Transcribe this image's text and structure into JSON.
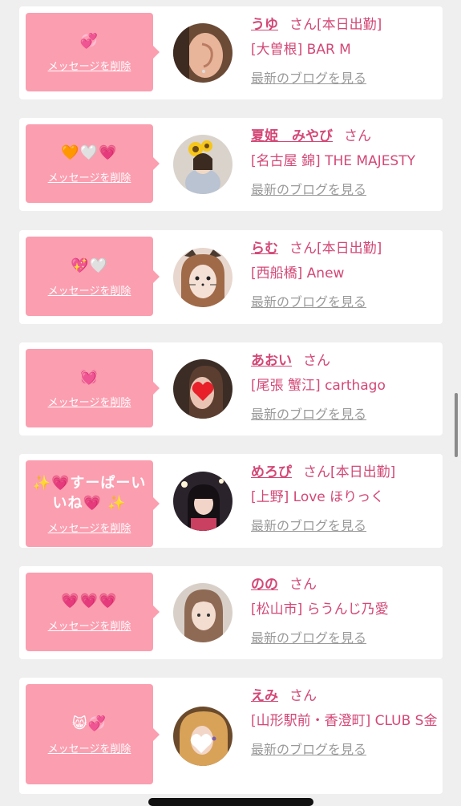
{
  "cards": [
    {
      "emoji": "💞",
      "name": "うゆ",
      "san": "さん",
      "status": "[本日出勤]",
      "shop": "[大曽根] BAR M",
      "delete": "メッセージを削除",
      "blog": "最新のブログを見る",
      "avatar": "ear"
    },
    {
      "emoji": "🧡🤍💗",
      "name": "夏姫　みやび",
      "san": "さん",
      "status": "",
      "shop": "[名古屋 錦] THE MAJESTY",
      "delete": "メッセージを削除",
      "blog": "最新のブログを見る",
      "avatar": "sunflower"
    },
    {
      "emoji": "💖🤍",
      "name": "らむ",
      "san": "さん",
      "status": "[本日出勤]",
      "shop": "[西船橋] Anew",
      "delete": "メッセージを削除",
      "blog": "最新のブログを見る",
      "avatar": "cat"
    },
    {
      "emoji": "💓",
      "name": "あおい",
      "san": "さん",
      "status": "",
      "shop": "[尾張 蟹江] carthago",
      "delete": "メッセージを削除",
      "blog": "最新のブログを見る",
      "avatar": "heart"
    },
    {
      "emoji": "✨💗すーぱーいいね💗 ✨",
      "name": "めろぴ",
      "san": "さん",
      "status": "[本日出勤]",
      "shop": "[上野] Love ほりっく",
      "delete": "メッセージを削除",
      "blog": "最新のブログを見る",
      "avatar": "dark"
    },
    {
      "emoji": "💗💗💗",
      "name": "のの",
      "san": "さん",
      "status": "",
      "shop": "[松山市] らうんじ乃愛",
      "delete": "メッセージを削除",
      "blog": "最新のブログを見る",
      "avatar": "girl"
    },
    {
      "emoji": "😸💞",
      "name": "えみ",
      "san": "さん",
      "status": "",
      "shop": "[山形駅前・香澄町] CLUB S金",
      "delete": "メッセージを削除",
      "blog": "最新のブログを見る",
      "avatar": "blond"
    }
  ],
  "colors": {
    "accent": "#d34876",
    "bubble": "#fb9eb0",
    "background": "#efefef"
  }
}
